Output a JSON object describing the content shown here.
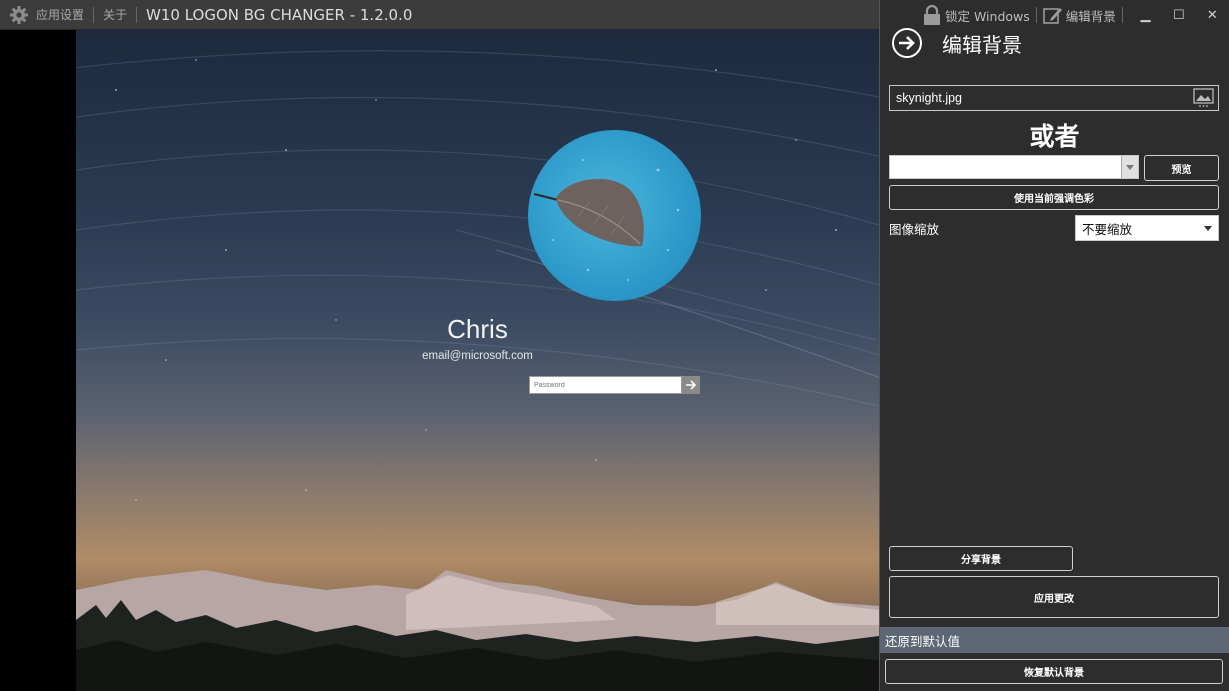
{
  "titlebar": {
    "settings_label": "应用设置",
    "about_label": "关于",
    "app_title": "W10 LOGON BG CHANGER - 1.2.0.0"
  },
  "panel_top": {
    "lock_label": "锁定 Windows",
    "edit_label": "编辑背景",
    "minimize": "▁",
    "maximize": "☐",
    "close": "✕"
  },
  "panel": {
    "heading": "编辑背景",
    "file_value": "skynight.jpg",
    "or_label": "或者",
    "color_value": "",
    "preview_button": "预览",
    "accent_button": "使用当前强调色彩",
    "scale_label": "图像缩放",
    "scale_value": "不要缩放",
    "share_button": "分享背景",
    "apply_button": "应用更改",
    "restore_section": "还原到默认值",
    "restore_button": "恢复默认背景"
  },
  "login": {
    "username": "Chris",
    "email": "email@microsoft.com",
    "password_placeholder": "Password"
  },
  "colors": {
    "titlebar": "#3c3c3c",
    "panel": "#2d2d2d",
    "restore_bar": "#5d6673",
    "avatar": "#3aa6d6"
  },
  "icons": {
    "settings": "gear-icon",
    "lock": "lock-icon",
    "edit": "edit-icon",
    "back": "arrow-right-circle-icon",
    "image_picker": "image-icon",
    "submit": "arrow-right-icon"
  }
}
